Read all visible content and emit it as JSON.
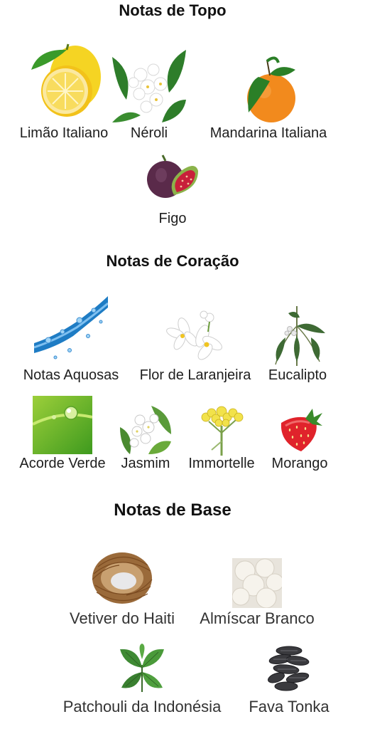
{
  "sections": {
    "topo": {
      "title": "Notas de Topo",
      "items": [
        {
          "label": "Limão Italiano",
          "icon": "lemon-icon"
        },
        {
          "label": "Néroli",
          "icon": "neroli-flower-icon"
        },
        {
          "label": "Mandarina Italiana",
          "icon": "mandarin-icon"
        },
        {
          "label": "Figo",
          "icon": "fig-icon"
        }
      ]
    },
    "coracao": {
      "title": "Notas de Coração",
      "items": [
        {
          "label": "Notas Aquosas",
          "icon": "water-splash-icon"
        },
        {
          "label": "Flor de Laranjeira",
          "icon": "orange-blossom-icon"
        },
        {
          "label": "Eucalipto",
          "icon": "eucalyptus-icon"
        },
        {
          "label": "Acorde Verde",
          "icon": "green-leaf-dew-icon"
        },
        {
          "label": "Jasmim",
          "icon": "jasmine-icon"
        },
        {
          "label": "Immortelle",
          "icon": "immortelle-flower-icon"
        },
        {
          "label": "Morango",
          "icon": "strawberry-icon"
        }
      ]
    },
    "base": {
      "title": "Notas de Base",
      "items": [
        {
          "label": "Vetiver do Haiti",
          "icon": "vetiver-roots-icon"
        },
        {
          "label": "Almíscar Branco",
          "icon": "white-musk-cotton-icon"
        },
        {
          "label": "Patchouli da Indonésia",
          "icon": "patchouli-leaf-icon"
        },
        {
          "label": "Fava Tonka",
          "icon": "tonka-bean-icon"
        }
      ]
    }
  },
  "colors": {
    "heading": "#111111",
    "label": "#1e1e1e",
    "lemon": "#f4d21f",
    "orange": "#f08a1c",
    "leaf": "#2f8a2a",
    "strawberry": "#e0232b"
  }
}
